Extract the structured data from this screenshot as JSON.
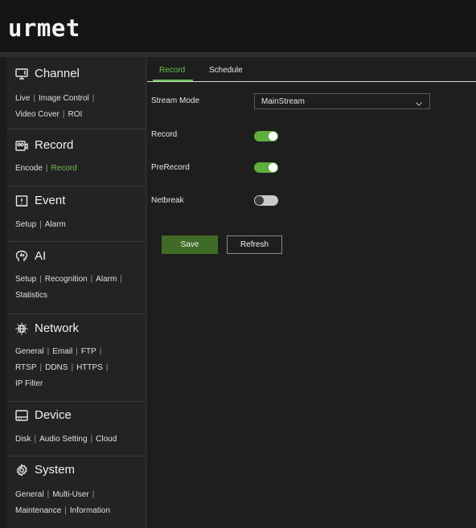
{
  "brand": {
    "logo_text": "urmet"
  },
  "sidebar": {
    "sections": [
      {
        "title": "Channel",
        "icon": "monitor-icon",
        "links": [
          "Live",
          "Image Control",
          "Video Cover",
          "ROI"
        ]
      },
      {
        "title": "Record",
        "icon": "record-icon",
        "links": [
          "Encode",
          "Record"
        ],
        "active_link": "Record"
      },
      {
        "title": "Event",
        "icon": "alarm-icon",
        "links": [
          "Setup",
          "Alarm"
        ]
      },
      {
        "title": "AI",
        "icon": "ai-icon",
        "links": [
          "Setup",
          "Recognition",
          "Alarm",
          "Statistics"
        ]
      },
      {
        "title": "Network",
        "icon": "globe-icon",
        "links": [
          "General",
          "Email",
          "FTP",
          "RTSP",
          "DDNS",
          "HTTPS",
          "IP Filter"
        ]
      },
      {
        "title": "Device",
        "icon": "hard-disk-icon",
        "links": [
          "Disk",
          "Audio Setting",
          "Cloud"
        ]
      },
      {
        "title": "System",
        "icon": "gear-icon",
        "links": [
          "General",
          "Multi-User",
          "Maintenance",
          "Information"
        ]
      }
    ]
  },
  "main": {
    "tabs": [
      {
        "label": "Record",
        "active": true
      },
      {
        "label": "Schedule",
        "active": false
      }
    ],
    "form": {
      "stream_mode_label": "Stream Mode",
      "stream_mode_value": "MainStream",
      "record_label": "Record",
      "record_on": true,
      "prerecord_label": "PreRecord",
      "prerecord_on": true,
      "netbreak_label": "Netbreak",
      "netbreak_on": false
    },
    "buttons": {
      "save_label": "Save",
      "refresh_label": "Refresh"
    }
  },
  "colors": {
    "accent": "#6cc04a",
    "save_bg": "#3f6b26",
    "toggle_on": "#5fae3d",
    "background": "#1b1b1c"
  }
}
